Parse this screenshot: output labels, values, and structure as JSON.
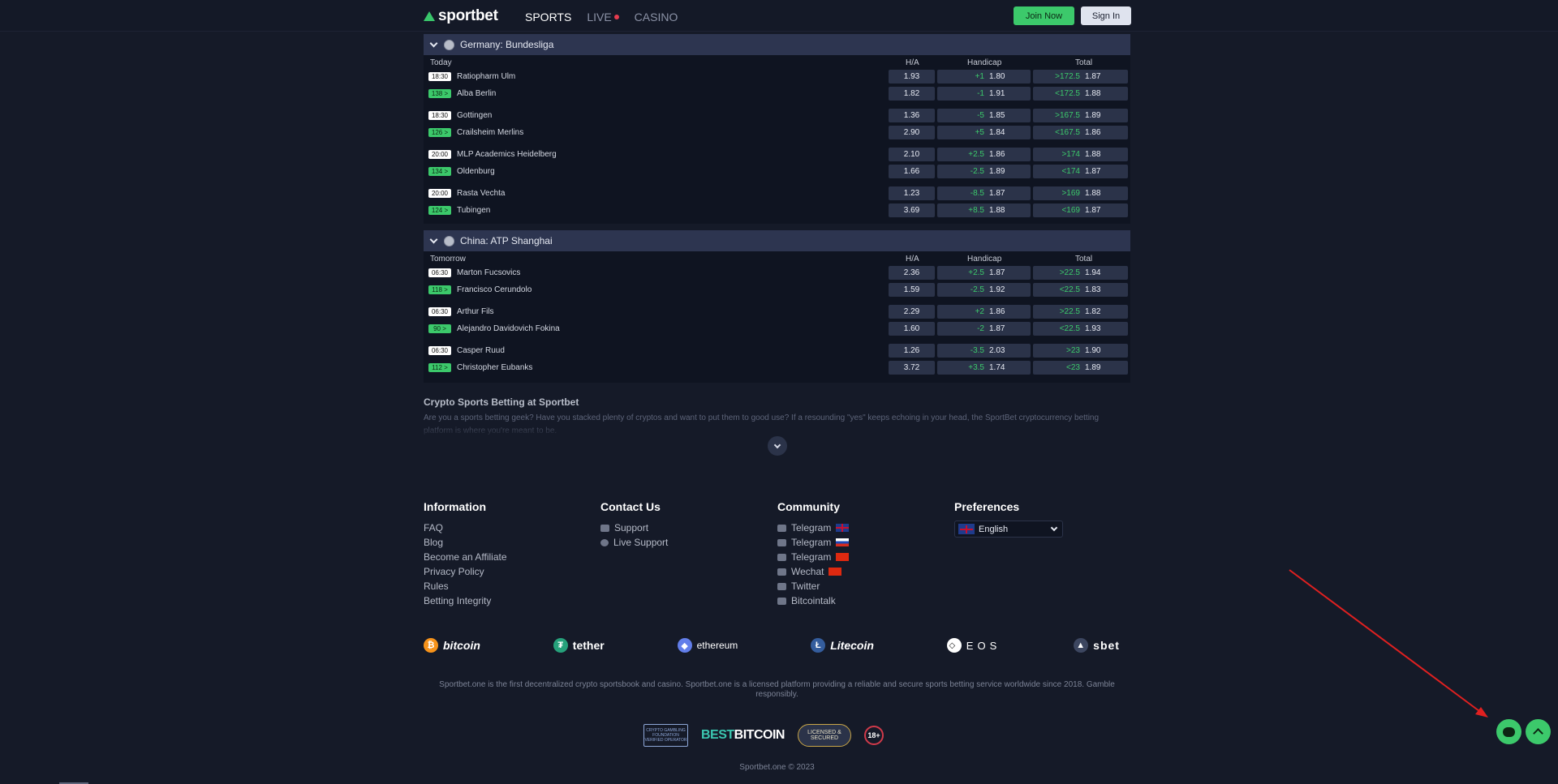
{
  "header": {
    "logo_text": "sportbet",
    "nav": {
      "sports": "SPORTS",
      "live": "LIVE",
      "casino": "CASINO"
    },
    "join_label": "Join Now",
    "signin_label": "Sign In"
  },
  "leagues": [
    {
      "name": "Germany: Bundesliga",
      "day": "Today",
      "col_ha": "H/A",
      "col_handicap": "Handicap",
      "col_total": "Total",
      "matches": [
        {
          "time": "18:30",
          "markets": "138 >",
          "home": "Ratiopharm Ulm",
          "away": "Alba Berlin",
          "ha": [
            "1.93",
            "1.82"
          ],
          "hc_line": [
            "+1",
            "-1"
          ],
          "hc_price": [
            "1.80",
            "1.91"
          ],
          "tot_line": [
            ">172.5",
            "<172.5"
          ],
          "tot_price": [
            "1.87",
            "1.88"
          ]
        },
        {
          "time": "18:30",
          "markets": "126 >",
          "home": "Gottingen",
          "away": "Crailsheim Merlins",
          "ha": [
            "1.36",
            "2.90"
          ],
          "hc_line": [
            "-5",
            "+5"
          ],
          "hc_price": [
            "1.85",
            "1.84"
          ],
          "tot_line": [
            ">167.5",
            "<167.5"
          ],
          "tot_price": [
            "1.89",
            "1.86"
          ]
        },
        {
          "time": "20:00",
          "markets": "134 >",
          "home": "MLP Academics Heidelberg",
          "away": "Oldenburg",
          "ha": [
            "2.10",
            "1.66"
          ],
          "hc_line": [
            "+2.5",
            "-2.5"
          ],
          "hc_price": [
            "1.86",
            "1.89"
          ],
          "tot_line": [
            ">174",
            "<174"
          ],
          "tot_price": [
            "1.88",
            "1.87"
          ]
        },
        {
          "time": "20:00",
          "markets": "124 >",
          "home": "Rasta Vechta",
          "away": "Tubingen",
          "ha": [
            "1.23",
            "3.69"
          ],
          "hc_line": [
            "-8.5",
            "+8.5"
          ],
          "hc_price": [
            "1.87",
            "1.88"
          ],
          "tot_line": [
            ">169",
            "<169"
          ],
          "tot_price": [
            "1.88",
            "1.87"
          ]
        }
      ]
    },
    {
      "name": "China: ATP Shanghai",
      "day": "Tomorrow",
      "col_ha": "H/A",
      "col_handicap": "Handicap",
      "col_total": "Total",
      "matches": [
        {
          "time": "06:30",
          "markets": "118 >",
          "home": "Marton Fucsovics",
          "away": "Francisco Cerundolo",
          "ha": [
            "2.36",
            "1.59"
          ],
          "hc_line": [
            "+2.5",
            "-2.5"
          ],
          "hc_price": [
            "1.87",
            "1.92"
          ],
          "tot_line": [
            ">22.5",
            "<22.5"
          ],
          "tot_price": [
            "1.94",
            "1.83"
          ]
        },
        {
          "time": "06:30",
          "markets": "90 >",
          "home": "Arthur Fils",
          "away": "Alejandro Davidovich Fokina",
          "ha": [
            "2.29",
            "1.60"
          ],
          "hc_line": [
            "+2",
            "-2"
          ],
          "hc_price": [
            "1.86",
            "1.87"
          ],
          "tot_line": [
            ">22.5",
            "<22.5"
          ],
          "tot_price": [
            "1.82",
            "1.93"
          ]
        },
        {
          "time": "06:30",
          "markets": "112 >",
          "home": "Casper Ruud",
          "away": "Christopher Eubanks",
          "ha": [
            "1.26",
            "3.72"
          ],
          "hc_line": [
            "-3.5",
            "+3.5"
          ],
          "hc_price": [
            "2.03",
            "1.74"
          ],
          "tot_line": [
            ">23",
            "<23"
          ],
          "tot_price": [
            "1.90",
            "1.89"
          ]
        }
      ]
    }
  ],
  "seo": {
    "title": "Crypto Sports Betting at Sportbet",
    "text": "Are you a sports betting geek? Have you stacked plenty of cryptos and want to put them to good use? If a resounding \"yes\" keeps echoing in your head, the SportBet cryptocurrency betting platform is where you're meant to be."
  },
  "footer": {
    "information": {
      "title": "Information",
      "links": [
        "FAQ",
        "Blog",
        "Become an Affiliate",
        "Privacy Policy",
        "Rules",
        "Betting Integrity"
      ]
    },
    "contact": {
      "title": "Contact Us",
      "links": [
        "Support",
        "Live Support"
      ]
    },
    "community": {
      "title": "Community",
      "links": [
        "Telegram",
        "Telegram",
        "Telegram",
        "Wechat",
        "Twitter",
        "Bitcointalk"
      ]
    },
    "preferences": {
      "title": "Preferences",
      "language": "English"
    },
    "coins": [
      "bitcoin",
      "tether",
      "ethereum",
      "Litecoin",
      "EOS",
      "sbet"
    ],
    "disclaimer": "Sportbet.one is the first decentralized crypto sportsbook and casino. Sportbet.one is a licensed platform providing a reliable and secure sports betting service worldwide since 2018. Gamble responsibly.",
    "badges": {
      "foundation": "CRYPTO GAMBLING FOUNDATION VERIFIED OPERATOR",
      "bestbtc_a": "BEST",
      "bestbtc_b": "BITCOIN",
      "licensed": "LICENSED & SECURED",
      "age": "18+"
    },
    "copyright": "Sportbet.one © 2023"
  },
  "colors": {
    "accent": "#3cc96b",
    "live": "#e63c4f",
    "annotation": "#e02020"
  }
}
